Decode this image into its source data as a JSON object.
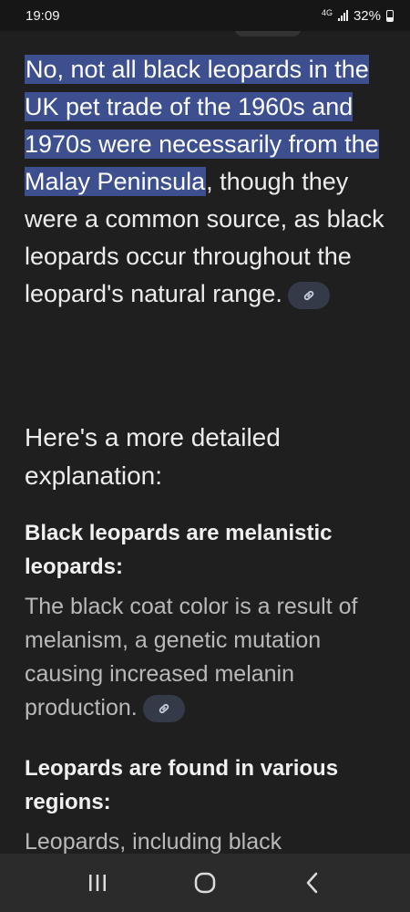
{
  "status_bar": {
    "time": "19:09",
    "network": "4G",
    "battery": "32%",
    "battery_level": 0.32,
    "icons": [
      "signal-icon",
      "battery-icon"
    ]
  },
  "answer": {
    "highlighted_text": "No, not all black leopards in the UK pet trade of the 1960s and 1970s were necessarily from the Malay Peninsula",
    "rest_text": ", though they were a common source, as black leopards occur throughout the leopard's natural range.",
    "link_icon": "link-icon"
  },
  "section": {
    "heading": "Here's a more detailed explanation:",
    "points": [
      {
        "title": "Black leopards are melanistic leopards:",
        "body": "The black coat color is a result of melanism, a genetic mutation causing increased melanin production."
      },
      {
        "title": "Leopards are found in various regions:",
        "body": "Leopards, including black"
      }
    ]
  },
  "nav_bar": {
    "icons": [
      "recent-apps-icon",
      "home-icon",
      "back-icon"
    ]
  },
  "colors": {
    "background": "#1f1f1f",
    "highlight": "#3d4f8f",
    "link_chip": "#343a47"
  }
}
